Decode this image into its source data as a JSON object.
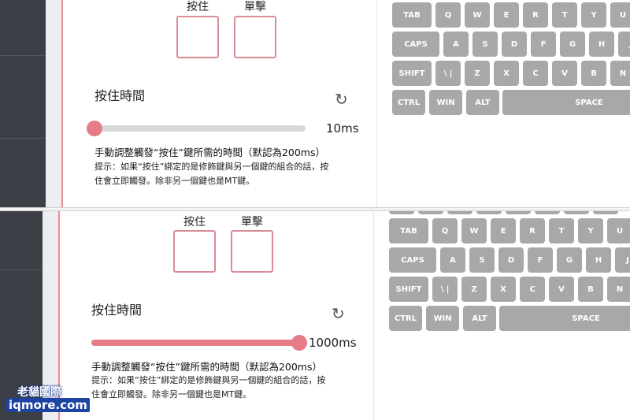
{
  "top": {
    "hold_label": "按住",
    "tap_label": "單擊",
    "title": "按住時間",
    "reset_icon": "refresh-icon",
    "slider_fraction": 0.0,
    "value": "10ms",
    "desc": "手動調整觸發“按住”鍵所需的時間（默認為200ms）",
    "hint_line1": "提示：如果“按住”綁定的是修飾鍵與另一個鍵的組合的話，按",
    "hint_line2": "住會立即觸發。除非另一個鍵也是MT鍵。"
  },
  "bottom": {
    "hold_label": "按住",
    "tap_label": "單擊",
    "title": "按住時間",
    "reset_icon": "refresh-icon",
    "slider_fraction": 1.0,
    "value": "1000ms",
    "desc": "手動調整觸發“按住”鍵所需的時間（默認為200ms）",
    "hint_line1": "提示：如果“按住”綁定的是修飾鍵與另一個鍵的組合的話，按",
    "hint_line2": "住會立即觸發。除非另一個鍵也是MT鍵。"
  },
  "keyboard": {
    "row1": [
      "TAB",
      "Q",
      "W",
      "E",
      "R",
      "T",
      "Y",
      "U"
    ],
    "row2": [
      "CAPS",
      "A",
      "S",
      "D",
      "F",
      "G",
      "H",
      "J"
    ],
    "row3": [
      "SHIFT",
      "\\ |",
      "Z",
      "X",
      "C",
      "V",
      "B",
      "N"
    ],
    "row4": [
      "CTRL",
      "WIN",
      "ALT",
      "SPACE"
    ]
  },
  "watermark": {
    "line1": "老貓國際",
    "line2": "iqmore.com"
  },
  "colors": {
    "accent": "#e57c88",
    "box_border": "#d98c95",
    "key": "#a8a8a8",
    "sidebar": "#3d3f46"
  }
}
